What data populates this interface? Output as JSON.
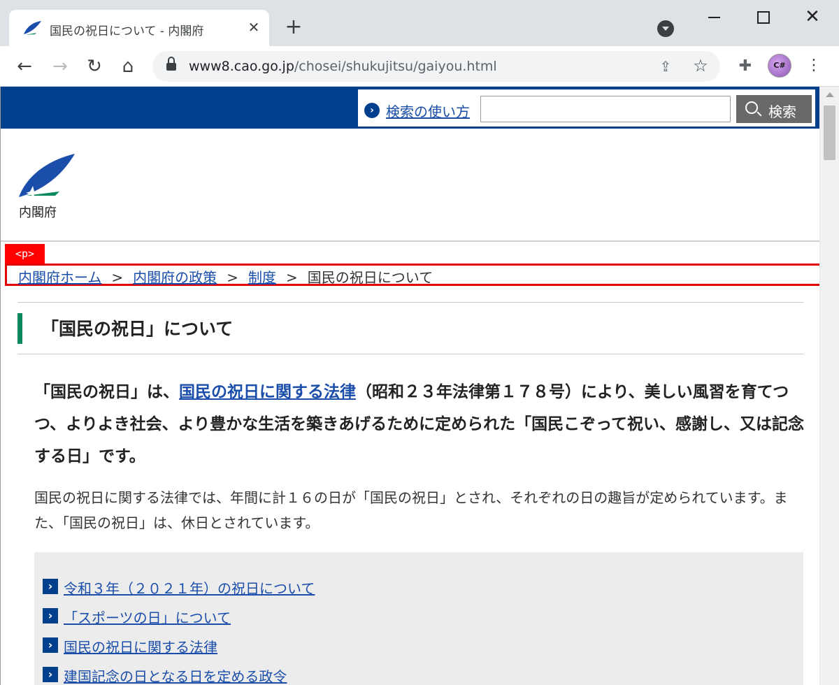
{
  "browser": {
    "tab_title": "国民の祝日について - 内閣府",
    "tab_close": "✕",
    "new_tab": "+",
    "url_host": "www8.cao.go.jp",
    "url_path": "/chosei/shukujitsu/gaiyou.html",
    "avatar_text": "C#"
  },
  "site": {
    "search_help_label": "検索の使い方",
    "search_input_value": "",
    "search_button_label": "検索",
    "logo_text": "内閣府"
  },
  "inspector": {
    "tag_label": "<p>"
  },
  "breadcrumb": {
    "items": [
      {
        "label": "内閣府ホーム"
      },
      {
        "label": "内閣府の政策"
      },
      {
        "label": "制度"
      }
    ],
    "current": "国民の祝日について",
    "separator": ">"
  },
  "main": {
    "title": "「国民の祝日」について",
    "lead_part1": "「国民の祝日」は、",
    "lead_link": "国民の祝日に関する法律",
    "lead_part2": "（昭和２３年法律第１７８号）により、美しい風習を育てつつ、よりよき社会、より豊かな生活を築きあげるために定められた「国民こぞって祝い、感謝し、又は記念する日」です。",
    "body": "国民の祝日に関する法律では、年間に計１６の日が「国民の祝日」とされ、それぞれの日の趣旨が定められています。また、「国民の祝日」は、休日とされています。",
    "links": [
      {
        "label": "令和３年（２０２１年）の祝日について"
      },
      {
        "label": "「スポーツの日」について"
      },
      {
        "label": "国民の祝日に関する法律"
      },
      {
        "label": "建国記念の日となる日を定める政令"
      }
    ]
  },
  "colors": {
    "header_blue": "#003f8c",
    "link_blue": "#1a4eaa",
    "accent_green": "#0a8a5c",
    "highlight_red": "#e00000"
  }
}
